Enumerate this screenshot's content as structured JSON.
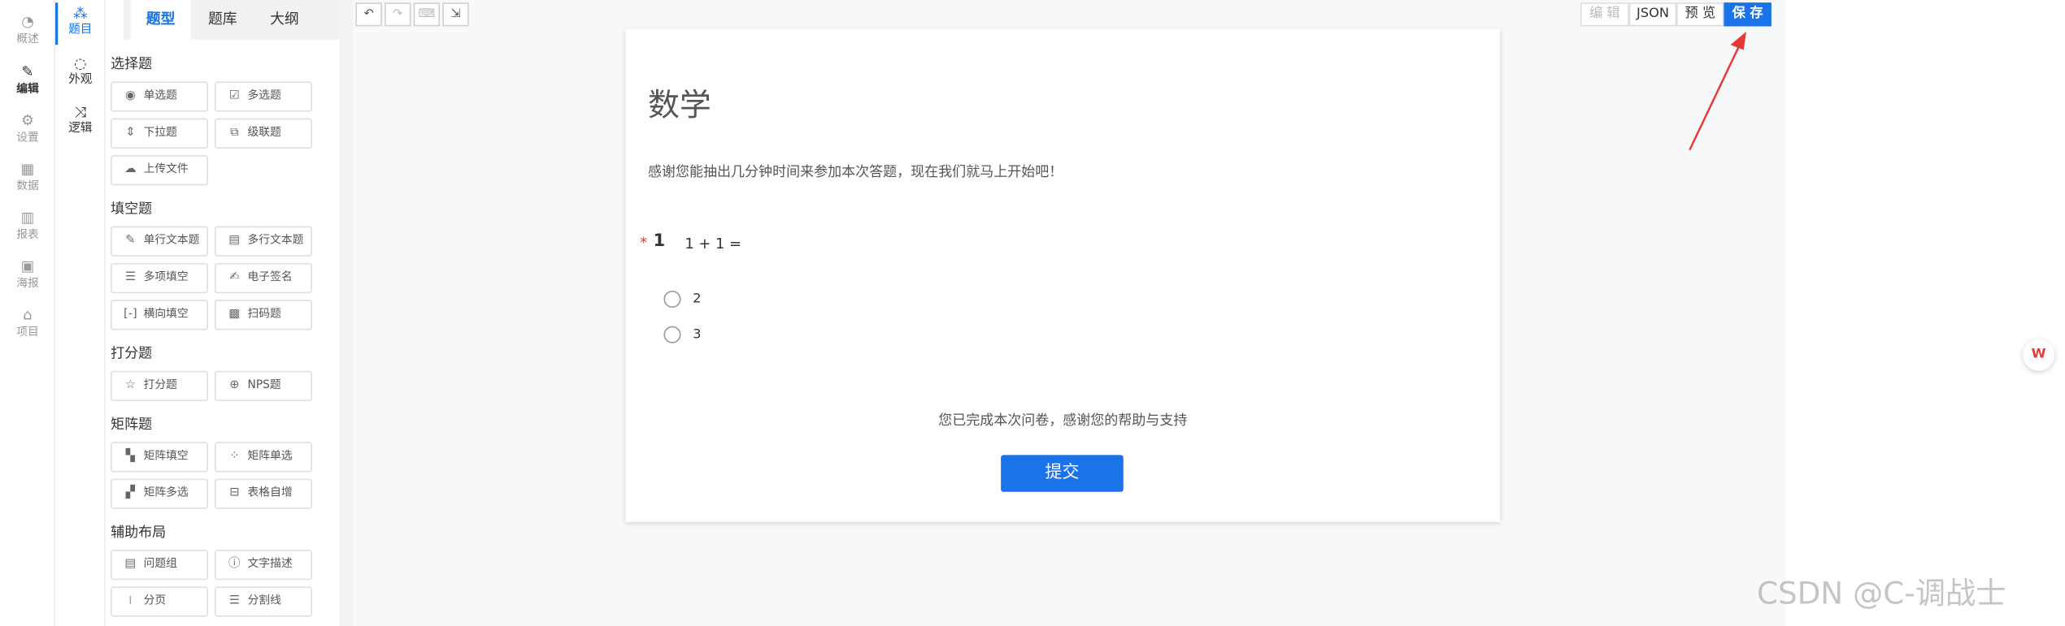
{
  "nav": [
    {
      "icon": "dashboard-icon",
      "label": "概述"
    },
    {
      "icon": "pen-icon",
      "label": "编辑"
    },
    {
      "icon": "gear-icon",
      "label": "设置"
    },
    {
      "icon": "table-icon",
      "label": "数据"
    },
    {
      "icon": "bar-chart-icon",
      "label": "报表"
    },
    {
      "icon": "image-icon",
      "label": "海报"
    },
    {
      "icon": "home-icon",
      "label": "项目"
    }
  ],
  "subnav": [
    {
      "icon": "grid-icon",
      "label": "题目"
    },
    {
      "icon": "palette-icon",
      "label": "外观"
    },
    {
      "icon": "shuffle-icon",
      "label": "逻辑"
    }
  ],
  "panel_tabs": [
    "题型",
    "题库",
    "大纲"
  ],
  "sections": [
    {
      "title": "选择题",
      "items": [
        {
          "icon": "radio-icon",
          "label": "单选题"
        },
        {
          "icon": "checkbox-icon",
          "label": "多选题"
        },
        {
          "icon": "dropdown-icon",
          "label": "下拉题"
        },
        {
          "icon": "cascade-icon",
          "label": "级联题"
        },
        {
          "icon": "upload-icon",
          "label": "上传文件"
        }
      ]
    },
    {
      "title": "填空题",
      "items": [
        {
          "icon": "edit-icon",
          "label": "单行文本题"
        },
        {
          "icon": "textarea-icon",
          "label": "多行文本题"
        },
        {
          "icon": "multi-fill-icon",
          "label": "多项填空"
        },
        {
          "icon": "signature-icon",
          "label": "电子签名"
        },
        {
          "icon": "inline-fill-icon",
          "label": "横向填空"
        },
        {
          "icon": "qrcode-icon",
          "label": "扫码题"
        }
      ]
    },
    {
      "title": "打分题",
      "items": [
        {
          "icon": "star-icon",
          "label": "打分题"
        },
        {
          "icon": "nps-icon",
          "label": "NPS题"
        }
      ]
    },
    {
      "title": "矩阵题",
      "items": [
        {
          "icon": "matrix-fill-icon",
          "label": "矩阵填空"
        },
        {
          "icon": "matrix-radio-icon",
          "label": "矩阵单选"
        },
        {
          "icon": "matrix-check-icon",
          "label": "矩阵多选"
        },
        {
          "icon": "table-grow-icon",
          "label": "表格自增"
        }
      ]
    },
    {
      "title": "辅助布局",
      "items": [
        {
          "icon": "group-icon",
          "label": "问题组"
        },
        {
          "icon": "info-icon",
          "label": "文字描述"
        },
        {
          "icon": "page-break-icon",
          "label": "分页"
        },
        {
          "icon": "divider-icon",
          "label": "分割线"
        }
      ]
    }
  ],
  "toolbar": {
    "left": [
      {
        "icon": "undo-icon",
        "disabled": false
      },
      {
        "icon": "redo-icon",
        "disabled": true
      },
      {
        "icon": "keyboard-icon",
        "disabled": true
      },
      {
        "icon": "export-icon",
        "disabled": false
      }
    ],
    "right": [
      {
        "label": "编 辑",
        "disabled": true
      },
      {
        "label": "JSON",
        "disabled": false
      },
      {
        "label": "预 览",
        "disabled": false
      },
      {
        "label": "保 存",
        "primary": true
      }
    ]
  },
  "survey": {
    "title": "数学",
    "description": "感谢您能抽出几分钟时间来参加本次答题，现在我们就马上开始吧！",
    "question": {
      "required_mark": "*",
      "number": "1",
      "title": "1 + 1 =",
      "options": [
        "2",
        "3"
      ]
    },
    "finish_text": "您已完成本次问卷，感谢您的帮助与支持",
    "submit_label": "提交"
  },
  "watermark": "CSDN @C-调战士",
  "accent_color": "#1a73e8",
  "annotation_color": "#e53935"
}
